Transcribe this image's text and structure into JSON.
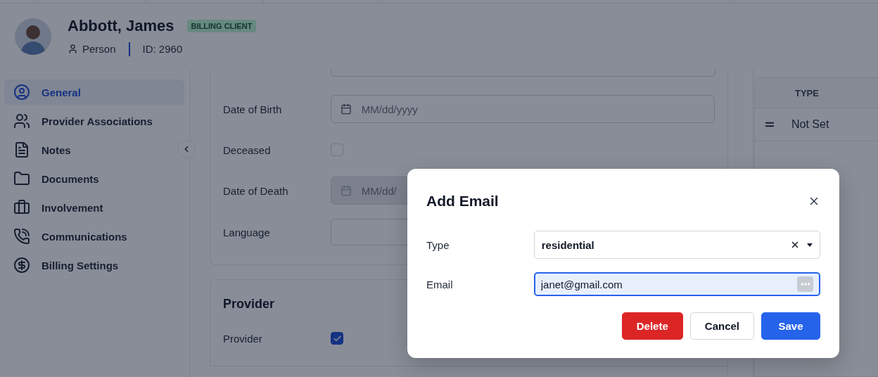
{
  "header": {
    "name": "Abbott, James",
    "badge": "BILLING CLIENT",
    "entity_type": "Person",
    "id": "ID: 2960"
  },
  "sidebar": {
    "items": [
      {
        "label": "General",
        "selected": true
      },
      {
        "label": "Provider Associations",
        "selected": false
      },
      {
        "label": "Notes",
        "selected": false
      },
      {
        "label": "Documents",
        "selected": false
      },
      {
        "label": "Involvement",
        "selected": false
      },
      {
        "label": "Communications",
        "selected": false
      },
      {
        "label": "Billing Settings",
        "selected": false
      }
    ]
  },
  "form": {
    "fields": [
      {
        "kind": "date",
        "label": "Date of Birth",
        "placeholder": "MM/dd/yyyy",
        "disabled": false
      },
      {
        "kind": "checkbox",
        "label": "Deceased",
        "checked": false
      },
      {
        "kind": "date",
        "label": "Date of Death",
        "placeholder": "MM/dd/",
        "disabled": true
      },
      {
        "kind": "text",
        "label": "Language"
      }
    ]
  },
  "provider_section": {
    "title": "Provider",
    "fields": [
      {
        "kind": "checkbox",
        "label": "Provider",
        "checked": true
      }
    ]
  },
  "table": {
    "columns": [
      "TYPE"
    ],
    "rows": [
      {
        "type": "Not Set",
        "kind": "drag"
      }
    ]
  },
  "dialog": {
    "title": "Add Email",
    "fields": [
      {
        "kind": "select",
        "label": "Type",
        "value": "residential"
      },
      {
        "kind": "email",
        "label": "Email",
        "value": "janet@gmail.com"
      }
    ],
    "buttons": [
      {
        "kind": "danger",
        "label": "Delete"
      },
      {
        "kind": "secondary",
        "label": "Cancel"
      },
      {
        "kind": "primary",
        "label": "Save"
      }
    ]
  }
}
